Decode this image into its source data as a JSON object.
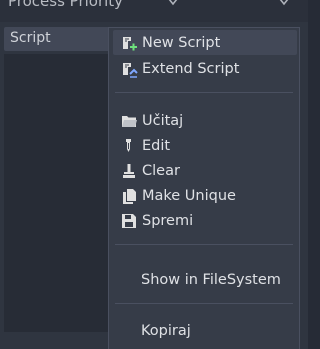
{
  "header": {
    "title": "Process Priority"
  },
  "panel": {
    "selected_label": "Script"
  },
  "menu": {
    "items": [
      {
        "label": "New Script",
        "icon": "new-script-icon"
      },
      {
        "label": "Extend Script",
        "icon": "extend-script-icon"
      },
      {
        "label": "Učitaj",
        "icon": "folder-icon"
      },
      {
        "label": "Edit",
        "icon": "edit-icon"
      },
      {
        "label": "Clear",
        "icon": "clear-icon"
      },
      {
        "label": "Make Unique",
        "icon": "duplicate-icon"
      },
      {
        "label": "Spremi",
        "icon": "save-icon"
      },
      {
        "label": "Show in FileSystem"
      },
      {
        "label": "Kopiraj"
      }
    ]
  },
  "colors": {
    "accent_green": "#6ee27d",
    "accent_blue": "#7fa7ff",
    "icon_light": "#e0e0e0"
  }
}
